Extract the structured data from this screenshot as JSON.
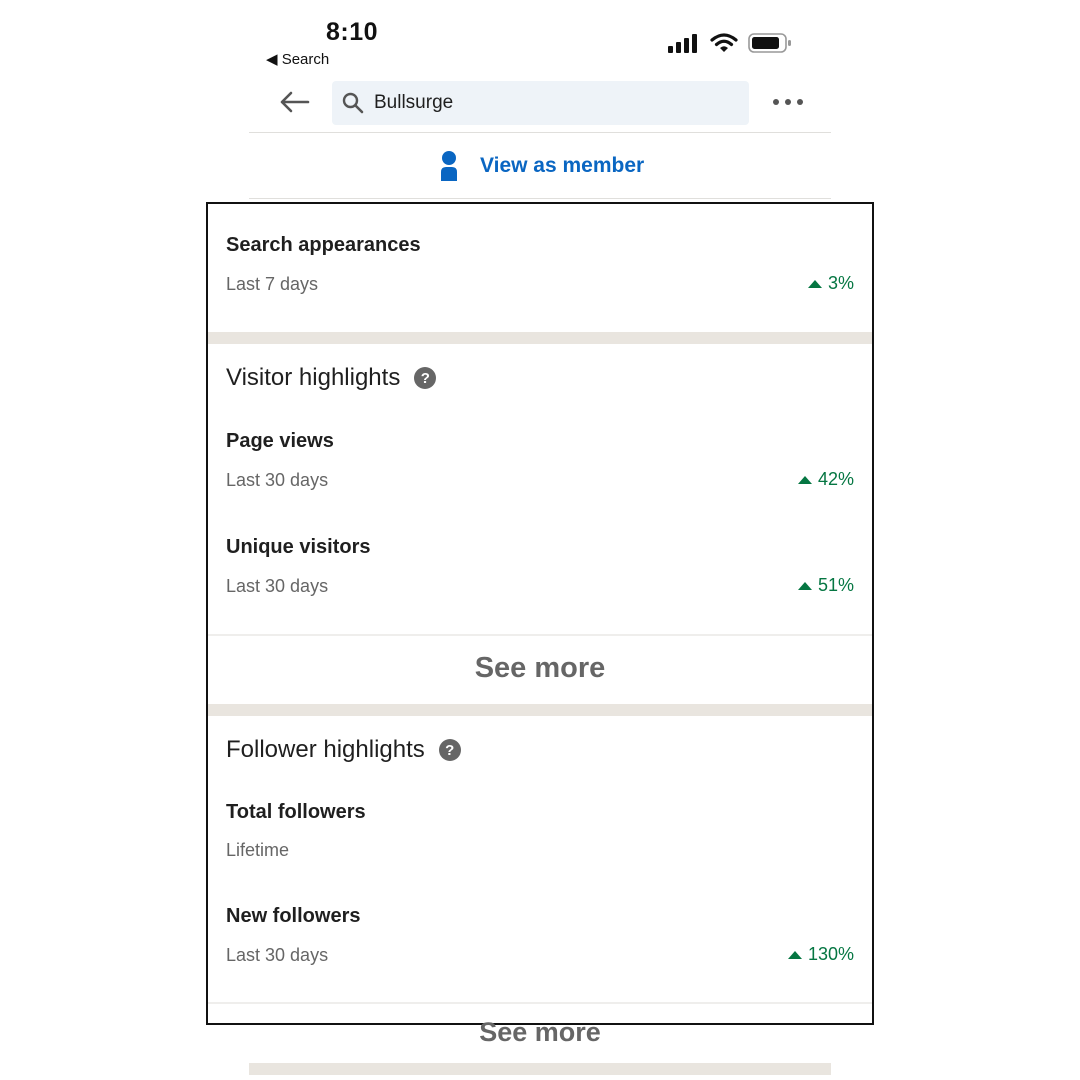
{
  "status_bar": {
    "time": "8:10",
    "back_to_app": "◀ Search"
  },
  "nav": {
    "search_value": "Bullsurge"
  },
  "view_as_member": "View as member",
  "search_appearances": {
    "title": "Search appearances",
    "period": "Last 7 days",
    "change": "3%"
  },
  "visitor_highlights": {
    "heading": "Visitor highlights",
    "metrics": [
      {
        "title": "Page views",
        "period": "Last 30 days",
        "change": "42%"
      },
      {
        "title": "Unique visitors",
        "period": "Last 30 days",
        "change": "51%"
      }
    ],
    "see_more": "See more"
  },
  "follower_highlights": {
    "heading": "Follower highlights",
    "metrics": [
      {
        "title": "Total followers",
        "period": "Lifetime"
      },
      {
        "title": "New followers",
        "period": "Last 30 days",
        "change": "130%"
      }
    ],
    "see_more": "See more"
  },
  "colors": {
    "accent_blue": "#0a66c2",
    "positive_green": "#057642",
    "muted_text": "#666666",
    "section_band": "#e9e5df"
  }
}
